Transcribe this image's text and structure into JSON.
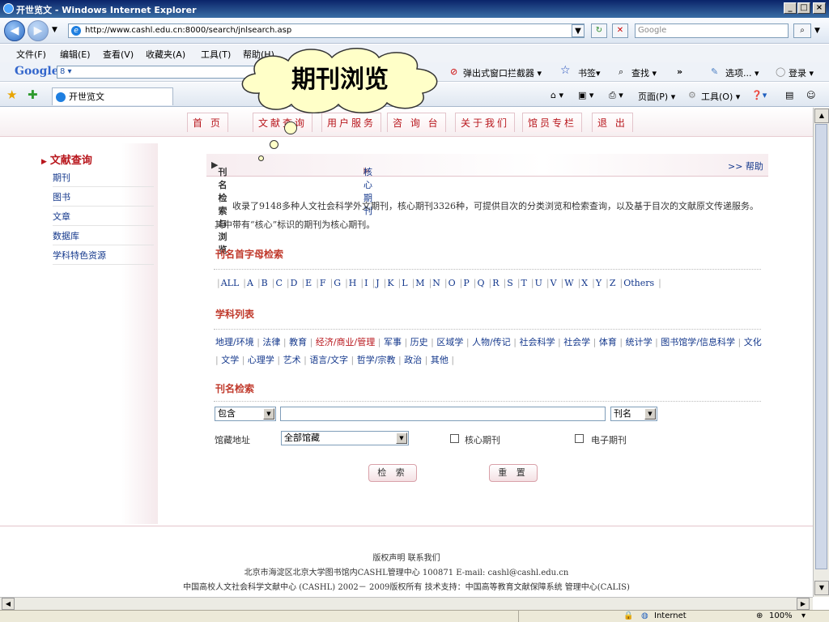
{
  "window": {
    "title": "开世览文 - Windows Internet Explorer",
    "min": "_",
    "max": "□",
    "close": "×"
  },
  "address": {
    "url": "http://www.cashl.edu.cn:8000/search/jnlsearch.asp",
    "search_placeholder": "Google"
  },
  "menubar": [
    "文件(F)",
    "编辑(E)",
    "查看(V)",
    "收藏夹(A)",
    "工具(T)",
    "帮助(H)"
  ],
  "google": {
    "logo": "Google",
    "box": "8 ▾",
    "popup_blocker": "弹出式窗口拦截器 ▾",
    "bookmarks": "书签▾",
    "find": "查找 ▾",
    "more": "»",
    "options": "选项... ▾",
    "login": "登录 ▾"
  },
  "tab": {
    "title": "开世览文",
    "page": "页面(P) ▾",
    "tools": "工具(O) ▾"
  },
  "callout": "期刊浏览",
  "sitenav": [
    "首 页",
    "文献查询",
    "用户服务",
    "咨 询 台",
    "关于我们",
    "馆员专栏",
    "退 出"
  ],
  "sidebar": {
    "heading": "文献查询",
    "items": [
      "期刊",
      "图书",
      "文章",
      "数据库",
      "学科特色资源"
    ]
  },
  "tabbar": {
    "active": "刊名检索与浏览",
    "core": "核心期刊",
    "help": ">> 帮助"
  },
  "description": "收录了9148多种人文社会科学外文期刊，核心期刊3326种，可提供目次的分类浏览和检索查询，以及基于目次的文献原文传递服务。其中带有“核心”标识的期刊为核心期刊。",
  "sections": {
    "alpha": "刊名首字母检索",
    "subject": "学科列表",
    "search": "刊名检索"
  },
  "alphabet": [
    "ALL",
    "A",
    "B",
    "C",
    "D",
    "E",
    "F",
    "G",
    "H",
    "I",
    "J",
    "K",
    "L",
    "M",
    "N",
    "O",
    "P",
    "Q",
    "R",
    "S",
    "T",
    "U",
    "V",
    "W",
    "X",
    "Y",
    "Z",
    "Others"
  ],
  "subjects": [
    "地理/环境",
    "法律",
    "教育",
    "经济/商业/管理",
    "军事",
    "历史",
    "区域学",
    "人物/传记",
    "社会科学",
    "社会学",
    "体育",
    "统计学",
    "图书馆学/信息科学",
    "文化",
    "文学",
    "心理学",
    "艺术",
    "语言/文字",
    "哲学/宗教",
    "政治",
    "其他"
  ],
  "form": {
    "match": "包含",
    "field": "刊名",
    "location_label": "馆藏地址",
    "location": "全部馆藏",
    "core_label": "核心期刊",
    "ejournal_label": "电子期刊",
    "search_btn": "检 索",
    "reset_btn": "重 置"
  },
  "footer": {
    "line1": "版权声明 联系我们",
    "line2": "北京市海淀区北京大学图书馆内CASHL管理中心 100871 E-mail: cashl@cashl.edu.cn",
    "line3": "中国高校人文社会科学文献中心 (CASHL) 2002－ 2009版权所有 技术支持：中国高等教育文献保障系统 管理中心(CALIS)"
  },
  "status": {
    "zone": "Internet",
    "zoom": "100%"
  }
}
